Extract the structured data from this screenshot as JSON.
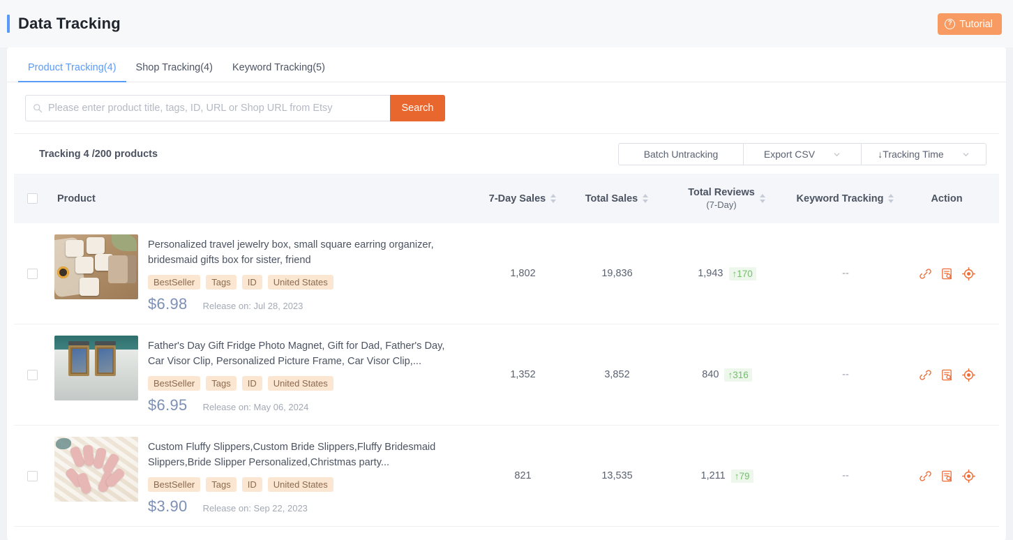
{
  "header": {
    "title": "Data Tracking",
    "tutorial_label": "Tutorial",
    "accent_blue": "#5b9bf8",
    "accent_orange": "#f89b63"
  },
  "tabs": [
    {
      "label": "Product Tracking(4)",
      "active": true
    },
    {
      "label": "Shop Tracking(4)",
      "active": false
    },
    {
      "label": "Keyword Tracking(5)",
      "active": false
    }
  ],
  "search": {
    "placeholder": "Please enter product title, tags, ID, URL or Shop URL from Etsy",
    "value": "",
    "button_label": "Search"
  },
  "toolbar": {
    "tracking_count": "Tracking 4 /200 products",
    "batch_untracking_label": "Batch Untracking",
    "export_csv_label": "Export CSV",
    "tracking_time_label": "↓Tracking Time"
  },
  "table": {
    "columns": {
      "product": "Product",
      "seven_day_sales": "7-Day Sales",
      "total_sales": "Total Sales",
      "total_reviews": "Total Reviews",
      "total_reviews_sub": "(7-Day)",
      "keyword_tracking": "Keyword Tracking",
      "action": "Action"
    },
    "rows": [
      {
        "title": "Personalized travel jewelry box, small square earring organizer, bridesmaid gifts box for sister, friend",
        "tags": [
          "BestSeller",
          "Tags",
          "ID",
          "United States"
        ],
        "price": "$6.98",
        "release": "Release on: Jul 28, 2023",
        "seven_day_sales": "1,802",
        "total_sales": "19,836",
        "total_reviews": "1,943",
        "reviews_delta": "↑170",
        "keyword_tracking": "--",
        "thumb": "jewelry-box-photo"
      },
      {
        "title": "Father's Day Gift Fridge Photo Magnet, Gift for Dad, Father's Day, Car Visor Clip, Personalized Picture Frame, Car Visor Clip,...",
        "tags": [
          "BestSeller",
          "Tags",
          "ID",
          "United States"
        ],
        "price": "$6.95",
        "release": "Release on: May 06, 2024",
        "seven_day_sales": "1,352",
        "total_sales": "3,852",
        "total_reviews": "840",
        "reviews_delta": "↑316",
        "keyword_tracking": "--",
        "thumb": "car-visor-magnet-photo"
      },
      {
        "title": "Custom Fluffy Slippers,Custom Bride Slippers,Fluffy Bridesmaid Slippers,Bride Slipper Personalized,Christmas party...",
        "tags": [
          "BestSeller",
          "Tags",
          "ID",
          "United States"
        ],
        "price": "$3.90",
        "release": "Release on: Sep 22, 2023",
        "seven_day_sales": "821",
        "total_sales": "13,535",
        "total_reviews": "1,211",
        "reviews_delta": "↑79",
        "keyword_tracking": "--",
        "thumb": "pink-slippers-photo"
      }
    ]
  },
  "icons": {
    "search": "search-icon",
    "help": "?",
    "link": "link-icon",
    "report": "report-search-icon",
    "target": "target-icon"
  },
  "colors": {
    "orange": "#e8672e",
    "blue": "#5b9bf8",
    "delta_green": "#76bd6e",
    "tag_bg": "#fbe6d2"
  }
}
